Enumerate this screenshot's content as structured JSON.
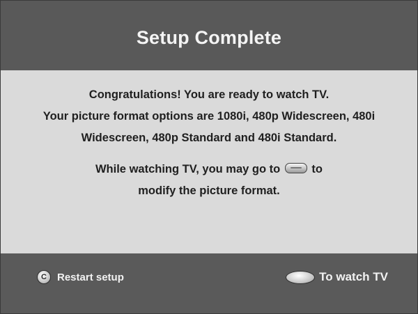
{
  "header": {
    "title": "Setup Complete"
  },
  "message": {
    "lines": [
      "Congratulations! You are ready to watch TV.",
      "Your picture format options are 1080i, 480p Widescreen, 480i",
      "Widescreen, 480p Standard and 480i Standard."
    ],
    "hint_before": "While watching TV, you may go to",
    "hint_after": "to",
    "hint_line2": "modify the picture format."
  },
  "footer": {
    "restart_button_glyph": "C",
    "restart_label": "Restart setup",
    "watch_label": "To watch TV"
  },
  "icons": {
    "restart": "c-button-icon",
    "watch": "select-button-icon",
    "format": "format-button-icon"
  }
}
